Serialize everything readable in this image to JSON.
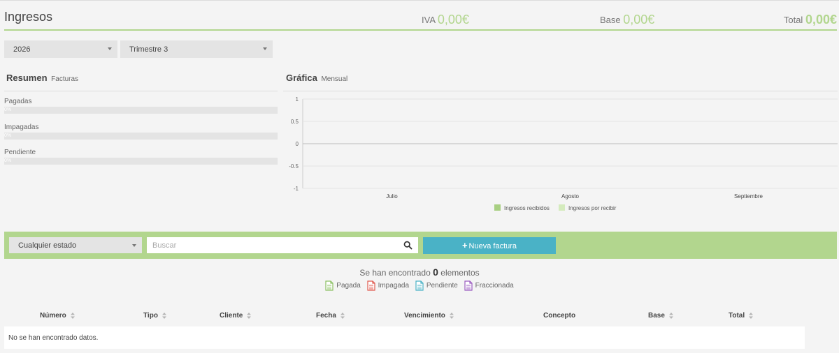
{
  "header": {
    "title": "Ingresos",
    "iva_label": "IVA",
    "iva_value": "0,00€",
    "base_label": "Base",
    "base_value": "0,00€",
    "total_label": "Total",
    "total_value": "0,00€"
  },
  "filters": {
    "year": "2026",
    "quarter": "Trimestre 3"
  },
  "resumen": {
    "title": "Resumen",
    "subtitle": "Facturas",
    "items": [
      {
        "label": "Pagadas",
        "percent_text": "0%",
        "fraction": 0
      },
      {
        "label": "Impagadas",
        "percent_text": "0%",
        "fraction": 0
      },
      {
        "label": "Pendiente",
        "percent_text": "0%",
        "fraction": 0
      }
    ]
  },
  "grafica": {
    "title": "Gráfica",
    "subtitle": "Mensual"
  },
  "chart_data": {
    "type": "bar",
    "categories": [
      "Julio",
      "Agosto",
      "Septiembre"
    ],
    "series": [
      {
        "name": "Ingresos recibidos",
        "values": [
          0,
          0,
          0
        ],
        "color": "#a8cf82"
      },
      {
        "name": "Ingresos por recibir",
        "values": [
          0,
          0,
          0
        ],
        "color": "#d4ebbd"
      }
    ],
    "yticks": [
      "1",
      "0.5",
      "0",
      "-0.5",
      "-1"
    ],
    "ylim": [
      -1,
      1
    ],
    "grid": true,
    "legend": "bottom"
  },
  "toolbar": {
    "estado_select": "Cualquier estado",
    "search_placeholder": "Buscar",
    "new_button": "Nueva factura"
  },
  "results": {
    "prefix": "Se han encontrado",
    "count": "0",
    "suffix": "elementos"
  },
  "status_legend": [
    {
      "label": "Pagada",
      "color": "#8cc063"
    },
    {
      "label": "Impagada",
      "color": "#e05a4f"
    },
    {
      "label": "Pendiente",
      "color": "#4ab2c6"
    },
    {
      "label": "Fraccionada",
      "color": "#9b5cc0"
    }
  ],
  "table": {
    "columns": [
      "Número",
      "Tipo",
      "Cliente",
      "Fecha",
      "Vencimiento",
      "Concepto",
      "Base",
      "Total"
    ],
    "empty_message": "No se han encontrado datos."
  },
  "colors": {
    "accent_green": "#b2d68e",
    "button_teal": "#4ab2c6"
  }
}
